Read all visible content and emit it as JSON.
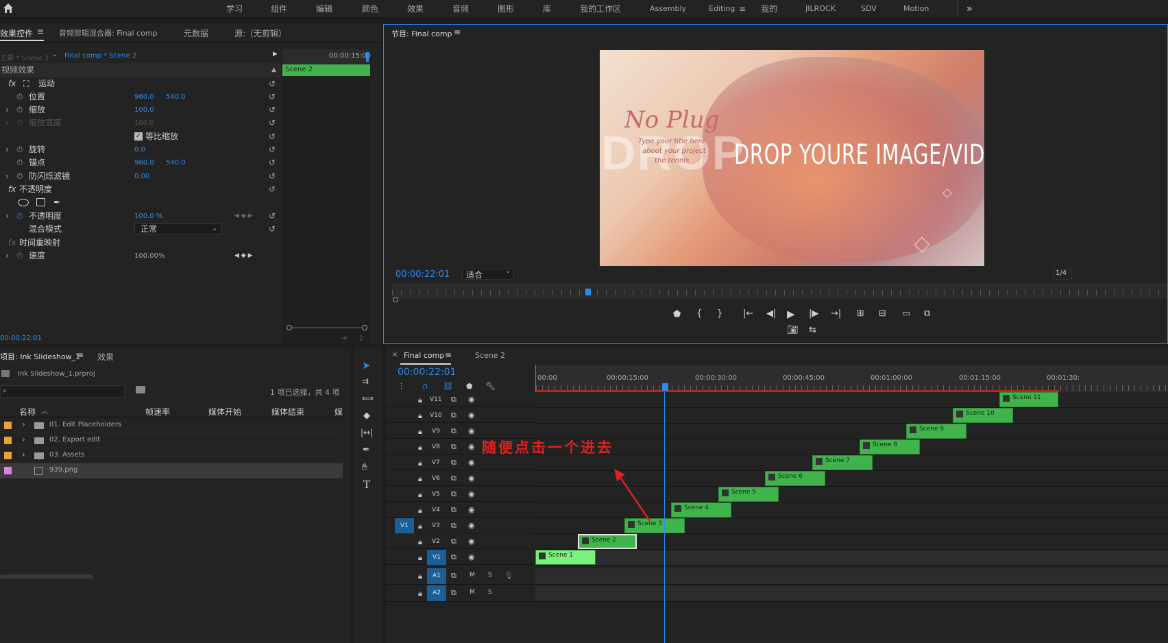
{
  "topbar": {
    "workspaces": [
      "学习",
      "组件",
      "编辑",
      "颜色",
      "效果",
      "音频",
      "图形",
      "库",
      "我的工作区",
      "Assembly",
      "Editing",
      "我的",
      "JILROCK",
      "SDV",
      "Motion"
    ],
    "active": "Editing",
    "more": "»"
  },
  "ec": {
    "tabs": [
      "效果控件",
      "音频剪辑混合器: Final comp",
      "元数据",
      "源:（无剪辑）"
    ],
    "src": "主要 * Scene 2",
    "seq": "Final comp * Scene 2",
    "tc_head": "00:00:15:00",
    "clip": "Scene 2",
    "header": "视频效果",
    "motion": "运动",
    "position": "位置",
    "pos_x": "960.0",
    "pos_y": "540.0",
    "scale": "缩放",
    "scale_v": "100.0",
    "scale_w": "缩放宽度",
    "scale_w_v": "100.0",
    "uniform": "等比缩放",
    "rotation": "旋转",
    "rotation_v": "0.0",
    "anchor": "锚点",
    "anchor_x": "960.0",
    "anchor_y": "540.0",
    "flicker": "防闪烁滤镜",
    "flicker_v": "0.00",
    "opacity_sec": "不透明度",
    "opacity": "不透明度",
    "opacity_v": "100.0 %",
    "blend": "混合模式",
    "blend_v": "正常",
    "remap": "时间重映射",
    "speed": "速度",
    "speed_v": "100.00%",
    "timecode": "00:00:22:01"
  },
  "program": {
    "title": "节目: Final comp",
    "timecode": "00:00:22:01",
    "fit": "适合",
    "ratio": "1/4",
    "frame": {
      "script": "No Plug",
      "sub1": "Type your title here",
      "sub2": "about your project",
      "sub3": "the tennis",
      "ghost": "DROP",
      "main": "DROP YOURE IMAGE/VIDEO"
    }
  },
  "project": {
    "tabs": [
      "项目: Ink Slideshow_1",
      "效果"
    ],
    "file": "Ink Slideshow_1.prproj",
    "count": "1 项已选择，共 4 项",
    "cols": [
      "名称",
      "帧速率",
      "媒体开始",
      "媒体结束",
      "媒"
    ],
    "items": [
      {
        "name": "01. Edit Placeholders",
        "color": "#e8a33a"
      },
      {
        "name": "02. Export edit",
        "color": "#e8a33a"
      },
      {
        "name": "03. Assets",
        "color": "#e8a33a"
      },
      {
        "name": "939.png",
        "color": "#e080e0"
      }
    ]
  },
  "timeline": {
    "tab": "Final comp",
    "tab2": "Scene 2",
    "timecode": "00:00:22:01",
    "ruler": [
      "00:00",
      "00:00:15:00",
      "00:00:30:00",
      "00:00:45:00",
      "00:01:00:00",
      "00:01:15:00",
      "00:01:30:"
    ],
    "video_tracks": [
      "V11",
      "V10",
      "V9",
      "V8",
      "V7",
      "V6",
      "V5",
      "V4",
      "V3",
      "V2",
      "V1"
    ],
    "audio_tracks": [
      "A1",
      "A2"
    ],
    "src_patch": "V1",
    "m": "M",
    "s": "S",
    "clips": [
      "Scene 11",
      "Scene 10",
      "Scene 9",
      "Scene 8",
      "Scene 7",
      "Scene 6",
      "Scene 5",
      "Scene 4",
      "Scene 3",
      "Scene 2",
      "Scene 1"
    ],
    "annotation": "随便点击一个进去"
  },
  "colors": {
    "accent": "#2d8ceb",
    "clip": "#41b34d",
    "annotation": "#e02020"
  }
}
